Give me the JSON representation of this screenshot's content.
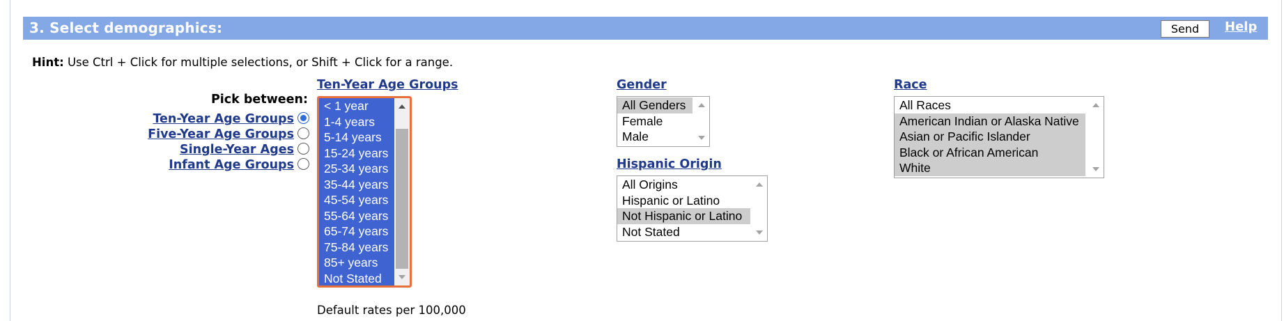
{
  "header": {
    "title": "3. Select demographics:",
    "send_label": "Send",
    "help_label": "Help",
    "background": "#84a7e6"
  },
  "hint": {
    "bold": "Hint:",
    "text": " Use Ctrl + Click for multiple selections, or Shift + Click for a range."
  },
  "pick_between": {
    "label": "Pick between:",
    "options": [
      {
        "label": "Ten-Year Age Groups",
        "checked": true
      },
      {
        "label": "Five-Year Age Groups",
        "checked": false
      },
      {
        "label": "Single-Year Ages",
        "checked": false
      },
      {
        "label": "Infant Age Groups",
        "checked": false
      }
    ]
  },
  "age": {
    "heading": "Ten-Year Age Groups",
    "items": [
      "< 1 year",
      "1-4 years",
      "5-14 years",
      "15-24 years",
      "25-34 years",
      "35-44 years",
      "45-54 years",
      "55-64 years",
      "65-74 years",
      "75-84 years",
      "85+ years",
      "Not Stated"
    ],
    "all_selected": true
  },
  "gender": {
    "heading": "Gender",
    "items": [
      "All Genders",
      "Female",
      "Male"
    ],
    "selected": [
      "All Genders"
    ]
  },
  "hispanic": {
    "heading": "Hispanic Origin",
    "items": [
      "All Origins",
      "Hispanic or Latino",
      "Not Hispanic or Latino",
      "Not Stated"
    ],
    "selected": [
      "Not Hispanic or Latino"
    ]
  },
  "race": {
    "heading": "Race",
    "items": [
      "All Races",
      "American Indian or Alaska Native",
      "Asian or Pacific Islander",
      "Black or African American",
      "White"
    ],
    "selected": [
      "American Indian or Alaska Native",
      "Asian or Pacific Islander",
      "Black or African American",
      "White"
    ]
  },
  "footer": {
    "default_rates": "Default rates per 100,000"
  },
  "colors": {
    "link": "#1f3a8c",
    "selection_blue": "#3f64d1",
    "selection_gray": "#cdcdcd",
    "focus_border": "#e8703a"
  }
}
